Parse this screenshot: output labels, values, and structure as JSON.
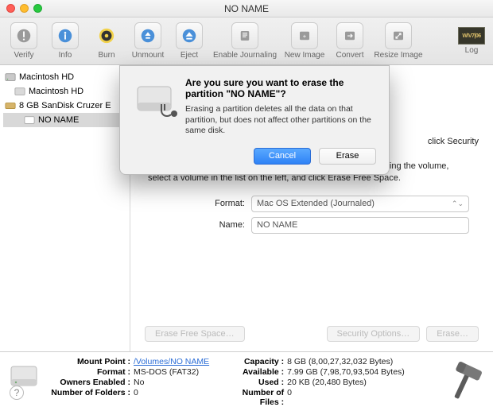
{
  "window_title": "NO NAME",
  "toolbar": {
    "verify": "Verify",
    "info": "Info",
    "burn": "Burn",
    "unmount": "Unmount",
    "eject": "Eject",
    "journal": "Enable Journaling",
    "newimg": "New Image",
    "convert": "Convert",
    "resize": "Resize Image",
    "log": "Log",
    "logbadge": "W\\V7|06"
  },
  "sidebar": {
    "hd": "Macintosh HD",
    "hdvol": "Macintosh HD",
    "usb": "8 GB SanDisk Cruzer E",
    "usbvol": "NO NAME"
  },
  "main": {
    "hint_tail": "click Security",
    "para": "To prevent the recovery of previously deleted files without erasing the volume, select a volume in the list on the left, and click Erase Free Space.",
    "format_label": "Format:",
    "format_value": "Mac OS Extended (Journaled)",
    "name_label": "Name:",
    "name_value": "NO NAME",
    "btn_efs": "Erase Free Space…",
    "btn_sec": "Security Options…",
    "btn_erase": "Erase…"
  },
  "footer": {
    "mount_k": "Mount Point :",
    "mount_v": "/Volumes/NO NAME",
    "format_k": "Format :",
    "format_v": "MS-DOS (FAT32)",
    "owners_k": "Owners Enabled :",
    "owners_v": "No",
    "folders_k": "Number of Folders :",
    "folders_v": "0",
    "cap_k": "Capacity :",
    "cap_v": "8 GB (8,00,27,32,032 Bytes)",
    "avail_k": "Available :",
    "avail_v": "7.99 GB (7,98,70,93,504 Bytes)",
    "used_k": "Used :",
    "used_v": "20 KB (20,480 Bytes)",
    "files_k": "Number of Files :",
    "files_v": "0"
  },
  "dialog": {
    "heading": "Are you sure you want to erase the partition \"NO NAME\"?",
    "body": "Erasing a partition deletes all the data on that partition, but does not affect other partitions on the same disk.",
    "cancel": "Cancel",
    "erase": "Erase"
  }
}
